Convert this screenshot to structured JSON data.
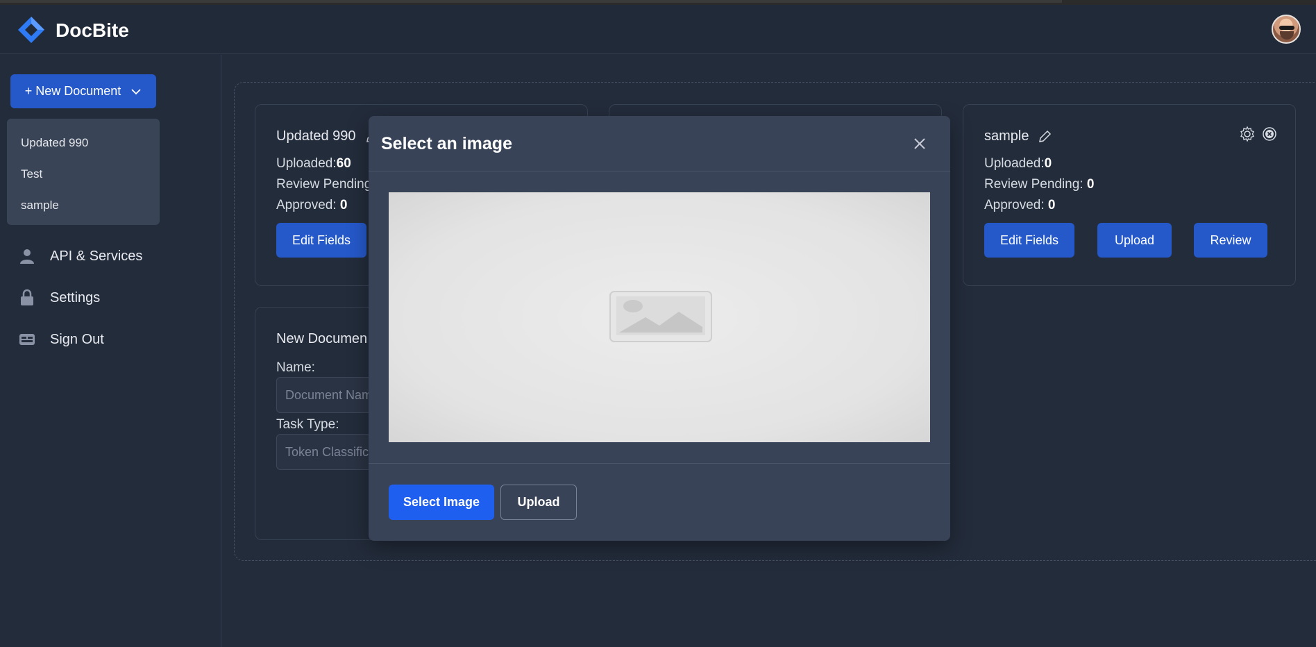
{
  "app": {
    "name": "DocBite",
    "brand_color": "#2f7bf5",
    "avatar_icon": "user-avatar"
  },
  "sidebar": {
    "new_document_label": "+ New Document",
    "documents": [
      "Updated 990",
      "Test",
      "sample"
    ],
    "nav": [
      {
        "label": "API & Services",
        "icon": "person-icon"
      },
      {
        "label": "Settings",
        "icon": "lock-icon"
      },
      {
        "label": "Sign Out",
        "icon": "card-icon"
      }
    ]
  },
  "cards": [
    {
      "title": "Updated 990",
      "uploaded_label": "Uploaded:",
      "uploaded": "60",
      "review_label": "Review Pending",
      "review": "",
      "approved_label": "Approved: ",
      "approved": "0",
      "edit_label": "Edit Fields"
    },
    {
      "title": "sample",
      "uploaded_label": "Uploaded:",
      "uploaded": "0",
      "review_label": "Review Pending: ",
      "review": "0",
      "approved_label": "Approved: ",
      "approved": "0",
      "edit_label": "Edit Fields",
      "upload_label": "Upload",
      "review_btn_label": "Review"
    }
  ],
  "new_document_form": {
    "title": "New Documen",
    "name_label": "Name:",
    "name_placeholder": "Document Nam",
    "task_label": "Task Type:",
    "task_value": "Token Classifica"
  },
  "modal": {
    "title": "Select an image",
    "select_button": "Select Image",
    "upload_button": "Upload"
  }
}
